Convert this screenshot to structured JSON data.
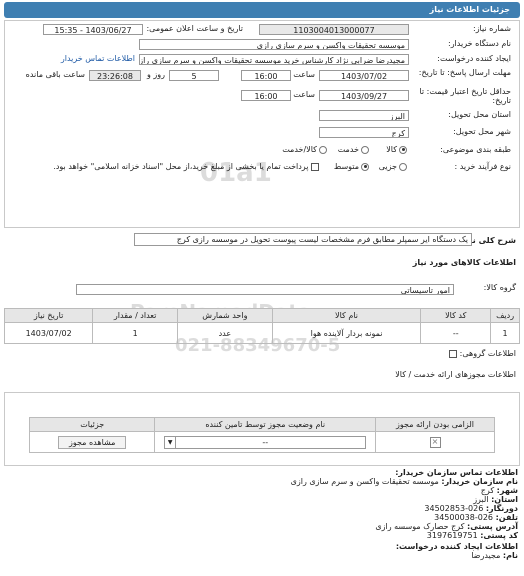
{
  "header_title": "جزئیات اطلاعات نیاز",
  "fields": {
    "need_number_label": "شماره نیاز:",
    "need_number": "1103004013000077",
    "announce_label": "تاریخ و ساعت اعلان عمومی:",
    "announce_value": "1403/06/27 - 15:35",
    "buyer_label": "نام دستگاه خریدار:",
    "buyer_value": "موسسه تحقیقات واکسن و سرم سازی رازی",
    "creator_label": "ایجاد کننده درخواست:",
    "creator_value": "مجیدرضا ضرابی نژاد کارشناس خرید موسسه تحقیقات واکسن و سرم سازی رازی",
    "contact_link": "اطلاعات تماس خریدار",
    "deadline_label": "مهلت ارسال پاسخ: تا تاریخ:",
    "deadline_date": "1403/07/02",
    "time_label": "ساعت",
    "deadline_time": "16:00",
    "days_value": "5",
    "days_label": "روز و",
    "remaining_value": "23:26:08",
    "remaining_label": "ساعت باقی مانده",
    "validity_label": "حداقل تاریخ اعتبار قیمت: تا تاریخ:",
    "validity_date": "1403/09/27",
    "validity_time": "16:00",
    "province_label": "استان محل تحویل:",
    "province_value": "البرز",
    "city_label": "شهر محل تحویل:",
    "city_value": "کرج",
    "category_label": "طبقه بندی موضوعی:",
    "cat_goods": "کالا",
    "cat_service": "خدمت",
    "cat_both": "کالا/خدمت",
    "process_label": "نوع فرآیند خرید :",
    "proc_partial": "جزیی",
    "proc_medium": "متوسط",
    "payment_note": "پرداخت تمام یا بخشی از مبلغ خرید،از محل \"اسناد خزانه اسلامی\" خواهد بود."
  },
  "summary": {
    "label": "شرح کلی نیاز:",
    "text": "یک دستگاه ایر سمپلر مطابق فرم مشخصات لیست پیوست تحویل در موسسه رازی کرج"
  },
  "goods": {
    "section_title": "اطلاعات کالاهای مورد نیاز",
    "group_label": "گروه کالا:",
    "group_value": "امور تاسیساتی",
    "columns": [
      "ردیف",
      "کد کالا",
      "نام کالا",
      "واحد شمارش",
      "تعداد / مقدار",
      "تاریخ نیاز"
    ],
    "rows": [
      [
        "1",
        "--",
        "نمونه بردار آلاینده هوا",
        "عدد",
        "1",
        "1403/07/02"
      ]
    ]
  },
  "group_ordering_label": "اطلاعات گروهی:",
  "permits": {
    "section_title": "اطلاعات مجوزهای ارائه خدمت / کالا",
    "columns": [
      "الزامی بودن ارائه مجوز",
      "نام وضعیت مجوز توسط تامین کننده",
      "جزئیات"
    ],
    "select_value": "--",
    "view_button": "مشاهده مجوز"
  },
  "buyer_contact": {
    "title": "اطلاعات تماس سازمان خریدار:",
    "org_label": "نام سازمان خریدار:",
    "org_value": "موسسه تحقیقات واکسن و سرم سازی رازی",
    "city_label": "شهر:",
    "city_value": "کرج",
    "province_label": "استان:",
    "province_value": "البرز",
    "fax_label": "دورنگار:",
    "fax_value": "026-34502853",
    "phone_label": "تلفن:",
    "phone_value": "026-34500038",
    "address_label": "آدرس پستی:",
    "address_value": "کرج حصارک موسسه رازی",
    "postal_label": "کد پستی:",
    "postal_value": "3197619751",
    "creator_title": "اطلاعات ایجاد کننده درخواست:",
    "name_label": "نام:",
    "name_value": "مجیدرضا"
  }
}
